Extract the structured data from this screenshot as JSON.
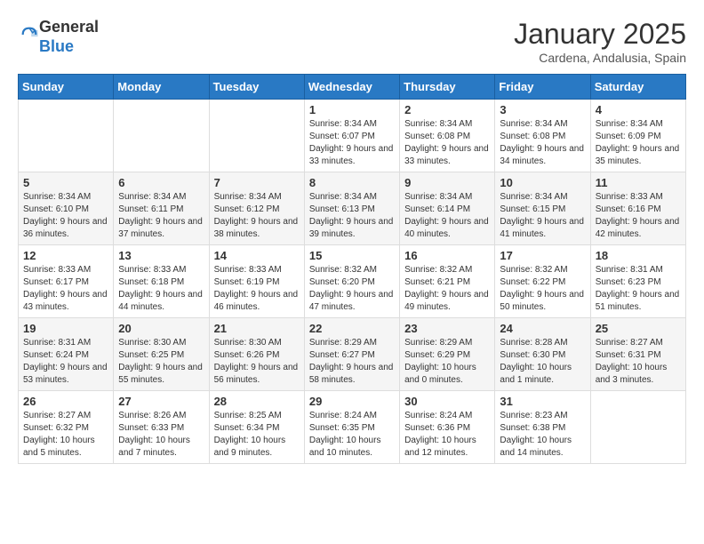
{
  "header": {
    "logo_line1": "General",
    "logo_line2": "Blue",
    "month_title": "January 2025",
    "location": "Cardena, Andalusia, Spain"
  },
  "days_of_week": [
    "Sunday",
    "Monday",
    "Tuesday",
    "Wednesday",
    "Thursday",
    "Friday",
    "Saturday"
  ],
  "weeks": [
    [
      {
        "day": "",
        "sunrise": "",
        "sunset": "",
        "daylight": ""
      },
      {
        "day": "",
        "sunrise": "",
        "sunset": "",
        "daylight": ""
      },
      {
        "day": "",
        "sunrise": "",
        "sunset": "",
        "daylight": ""
      },
      {
        "day": "1",
        "sunrise": "Sunrise: 8:34 AM",
        "sunset": "Sunset: 6:07 PM",
        "daylight": "Daylight: 9 hours and 33 minutes."
      },
      {
        "day": "2",
        "sunrise": "Sunrise: 8:34 AM",
        "sunset": "Sunset: 6:08 PM",
        "daylight": "Daylight: 9 hours and 33 minutes."
      },
      {
        "day": "3",
        "sunrise": "Sunrise: 8:34 AM",
        "sunset": "Sunset: 6:08 PM",
        "daylight": "Daylight: 9 hours and 34 minutes."
      },
      {
        "day": "4",
        "sunrise": "Sunrise: 8:34 AM",
        "sunset": "Sunset: 6:09 PM",
        "daylight": "Daylight: 9 hours and 35 minutes."
      }
    ],
    [
      {
        "day": "5",
        "sunrise": "Sunrise: 8:34 AM",
        "sunset": "Sunset: 6:10 PM",
        "daylight": "Daylight: 9 hours and 36 minutes."
      },
      {
        "day": "6",
        "sunrise": "Sunrise: 8:34 AM",
        "sunset": "Sunset: 6:11 PM",
        "daylight": "Daylight: 9 hours and 37 minutes."
      },
      {
        "day": "7",
        "sunrise": "Sunrise: 8:34 AM",
        "sunset": "Sunset: 6:12 PM",
        "daylight": "Daylight: 9 hours and 38 minutes."
      },
      {
        "day": "8",
        "sunrise": "Sunrise: 8:34 AM",
        "sunset": "Sunset: 6:13 PM",
        "daylight": "Daylight: 9 hours and 39 minutes."
      },
      {
        "day": "9",
        "sunrise": "Sunrise: 8:34 AM",
        "sunset": "Sunset: 6:14 PM",
        "daylight": "Daylight: 9 hours and 40 minutes."
      },
      {
        "day": "10",
        "sunrise": "Sunrise: 8:34 AM",
        "sunset": "Sunset: 6:15 PM",
        "daylight": "Daylight: 9 hours and 41 minutes."
      },
      {
        "day": "11",
        "sunrise": "Sunrise: 8:33 AM",
        "sunset": "Sunset: 6:16 PM",
        "daylight": "Daylight: 9 hours and 42 minutes."
      }
    ],
    [
      {
        "day": "12",
        "sunrise": "Sunrise: 8:33 AM",
        "sunset": "Sunset: 6:17 PM",
        "daylight": "Daylight: 9 hours and 43 minutes."
      },
      {
        "day": "13",
        "sunrise": "Sunrise: 8:33 AM",
        "sunset": "Sunset: 6:18 PM",
        "daylight": "Daylight: 9 hours and 44 minutes."
      },
      {
        "day": "14",
        "sunrise": "Sunrise: 8:33 AM",
        "sunset": "Sunset: 6:19 PM",
        "daylight": "Daylight: 9 hours and 46 minutes."
      },
      {
        "day": "15",
        "sunrise": "Sunrise: 8:32 AM",
        "sunset": "Sunset: 6:20 PM",
        "daylight": "Daylight: 9 hours and 47 minutes."
      },
      {
        "day": "16",
        "sunrise": "Sunrise: 8:32 AM",
        "sunset": "Sunset: 6:21 PM",
        "daylight": "Daylight: 9 hours and 49 minutes."
      },
      {
        "day": "17",
        "sunrise": "Sunrise: 8:32 AM",
        "sunset": "Sunset: 6:22 PM",
        "daylight": "Daylight: 9 hours and 50 minutes."
      },
      {
        "day": "18",
        "sunrise": "Sunrise: 8:31 AM",
        "sunset": "Sunset: 6:23 PM",
        "daylight": "Daylight: 9 hours and 51 minutes."
      }
    ],
    [
      {
        "day": "19",
        "sunrise": "Sunrise: 8:31 AM",
        "sunset": "Sunset: 6:24 PM",
        "daylight": "Daylight: 9 hours and 53 minutes."
      },
      {
        "day": "20",
        "sunrise": "Sunrise: 8:30 AM",
        "sunset": "Sunset: 6:25 PM",
        "daylight": "Daylight: 9 hours and 55 minutes."
      },
      {
        "day": "21",
        "sunrise": "Sunrise: 8:30 AM",
        "sunset": "Sunset: 6:26 PM",
        "daylight": "Daylight: 9 hours and 56 minutes."
      },
      {
        "day": "22",
        "sunrise": "Sunrise: 8:29 AM",
        "sunset": "Sunset: 6:27 PM",
        "daylight": "Daylight: 9 hours and 58 minutes."
      },
      {
        "day": "23",
        "sunrise": "Sunrise: 8:29 AM",
        "sunset": "Sunset: 6:29 PM",
        "daylight": "Daylight: 10 hours and 0 minutes."
      },
      {
        "day": "24",
        "sunrise": "Sunrise: 8:28 AM",
        "sunset": "Sunset: 6:30 PM",
        "daylight": "Daylight: 10 hours and 1 minute."
      },
      {
        "day": "25",
        "sunrise": "Sunrise: 8:27 AM",
        "sunset": "Sunset: 6:31 PM",
        "daylight": "Daylight: 10 hours and 3 minutes."
      }
    ],
    [
      {
        "day": "26",
        "sunrise": "Sunrise: 8:27 AM",
        "sunset": "Sunset: 6:32 PM",
        "daylight": "Daylight: 10 hours and 5 minutes."
      },
      {
        "day": "27",
        "sunrise": "Sunrise: 8:26 AM",
        "sunset": "Sunset: 6:33 PM",
        "daylight": "Daylight: 10 hours and 7 minutes."
      },
      {
        "day": "28",
        "sunrise": "Sunrise: 8:25 AM",
        "sunset": "Sunset: 6:34 PM",
        "daylight": "Daylight: 10 hours and 9 minutes."
      },
      {
        "day": "29",
        "sunrise": "Sunrise: 8:24 AM",
        "sunset": "Sunset: 6:35 PM",
        "daylight": "Daylight: 10 hours and 10 minutes."
      },
      {
        "day": "30",
        "sunrise": "Sunrise: 8:24 AM",
        "sunset": "Sunset: 6:36 PM",
        "daylight": "Daylight: 10 hours and 12 minutes."
      },
      {
        "day": "31",
        "sunrise": "Sunrise: 8:23 AM",
        "sunset": "Sunset: 6:38 PM",
        "daylight": "Daylight: 10 hours and 14 minutes."
      },
      {
        "day": "",
        "sunrise": "",
        "sunset": "",
        "daylight": ""
      }
    ]
  ]
}
